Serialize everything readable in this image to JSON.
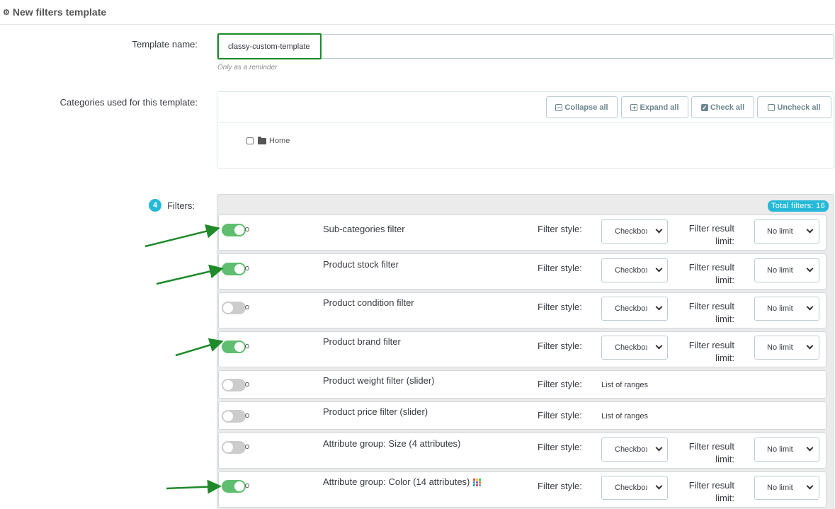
{
  "header": {
    "title": "New filters template",
    "icon": "cogs-icon"
  },
  "template_name": {
    "label": "Template name:",
    "value": "classy-custom-template",
    "help": "Only as a reminder"
  },
  "categories": {
    "label": "Categories used for this template:",
    "buttons": {
      "collapse": "Collapse all",
      "expand": "Expand all",
      "check": "Check all",
      "uncheck": "Uncheck all"
    },
    "tree": [
      {
        "label": "Home",
        "checked": false,
        "icon": "folder-icon"
      }
    ]
  },
  "filters": {
    "label": "Filters:",
    "count": "4",
    "total": "Total filters: 16",
    "style_label": "Filter style:",
    "limit_label": "Filter result limit:",
    "items": [
      {
        "name": "Sub-categories filter",
        "enabled": true,
        "style": "Checkbox",
        "limit": "No limit"
      },
      {
        "name": "Product stock filter",
        "enabled": true,
        "style": "Checkbox",
        "limit": "No limit"
      },
      {
        "name": "Product condition filter",
        "enabled": false,
        "style": "Checkbox",
        "limit": "No limit"
      },
      {
        "name": "Product brand filter",
        "enabled": true,
        "style": "Checkbox",
        "limit": "No limit"
      },
      {
        "name": "Product weight filter (slider)",
        "enabled": false,
        "style": "List of ranges",
        "limit": null
      },
      {
        "name": "Product price filter (slider)",
        "enabled": false,
        "style": "List of ranges",
        "limit": null
      },
      {
        "name": "Attribute group: Size (4 attributes)",
        "enabled": false,
        "style": "Checkbox",
        "limit": "No limit"
      },
      {
        "name": "Attribute group: Color (14 attributes)",
        "enabled": true,
        "style": "Checkbox",
        "limit": "No limit",
        "icon": "color-palette-icon"
      }
    ]
  },
  "colors": {
    "accent": "#25b9d7",
    "toggle_on": "#5fbe6f",
    "annotation": "#1f8a2a"
  }
}
